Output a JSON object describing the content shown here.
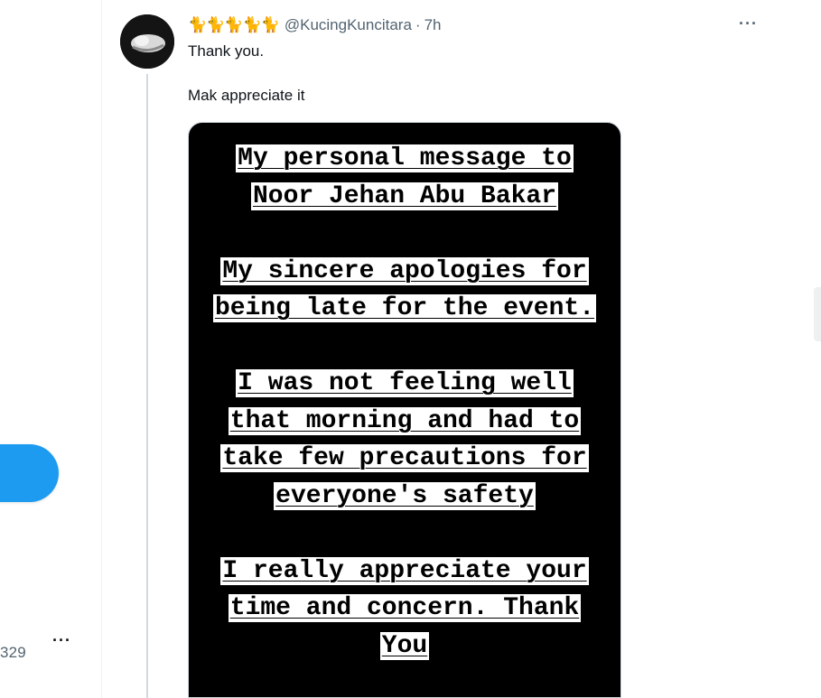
{
  "sidebar": {
    "profile_count": "329",
    "more_icon": "more-icon"
  },
  "tweet": {
    "display_name_emoji": "🐈🐈🐈🐈🐈",
    "handle": "@KucingKuncitara",
    "separator": "·",
    "time": "7h",
    "more_icon": "···",
    "text_line1": "Thank you.",
    "text_line2": "Mak appreciate it",
    "image": {
      "lines": [
        "My personal message to",
        "Noor Jehan Abu Bakar",
        "",
        "My sincere apologies for",
        "being late for the event.",
        "",
        "I was not feeling well",
        "that morning and had to",
        "take few precautions for",
        "everyone's safety",
        "",
        "I really appreciate your",
        "time and concern. Thank",
        "You"
      ]
    }
  },
  "colors": {
    "accent": "#1d9bf0",
    "secondary_text": "#536471",
    "thread_line": "#cfd9de"
  }
}
